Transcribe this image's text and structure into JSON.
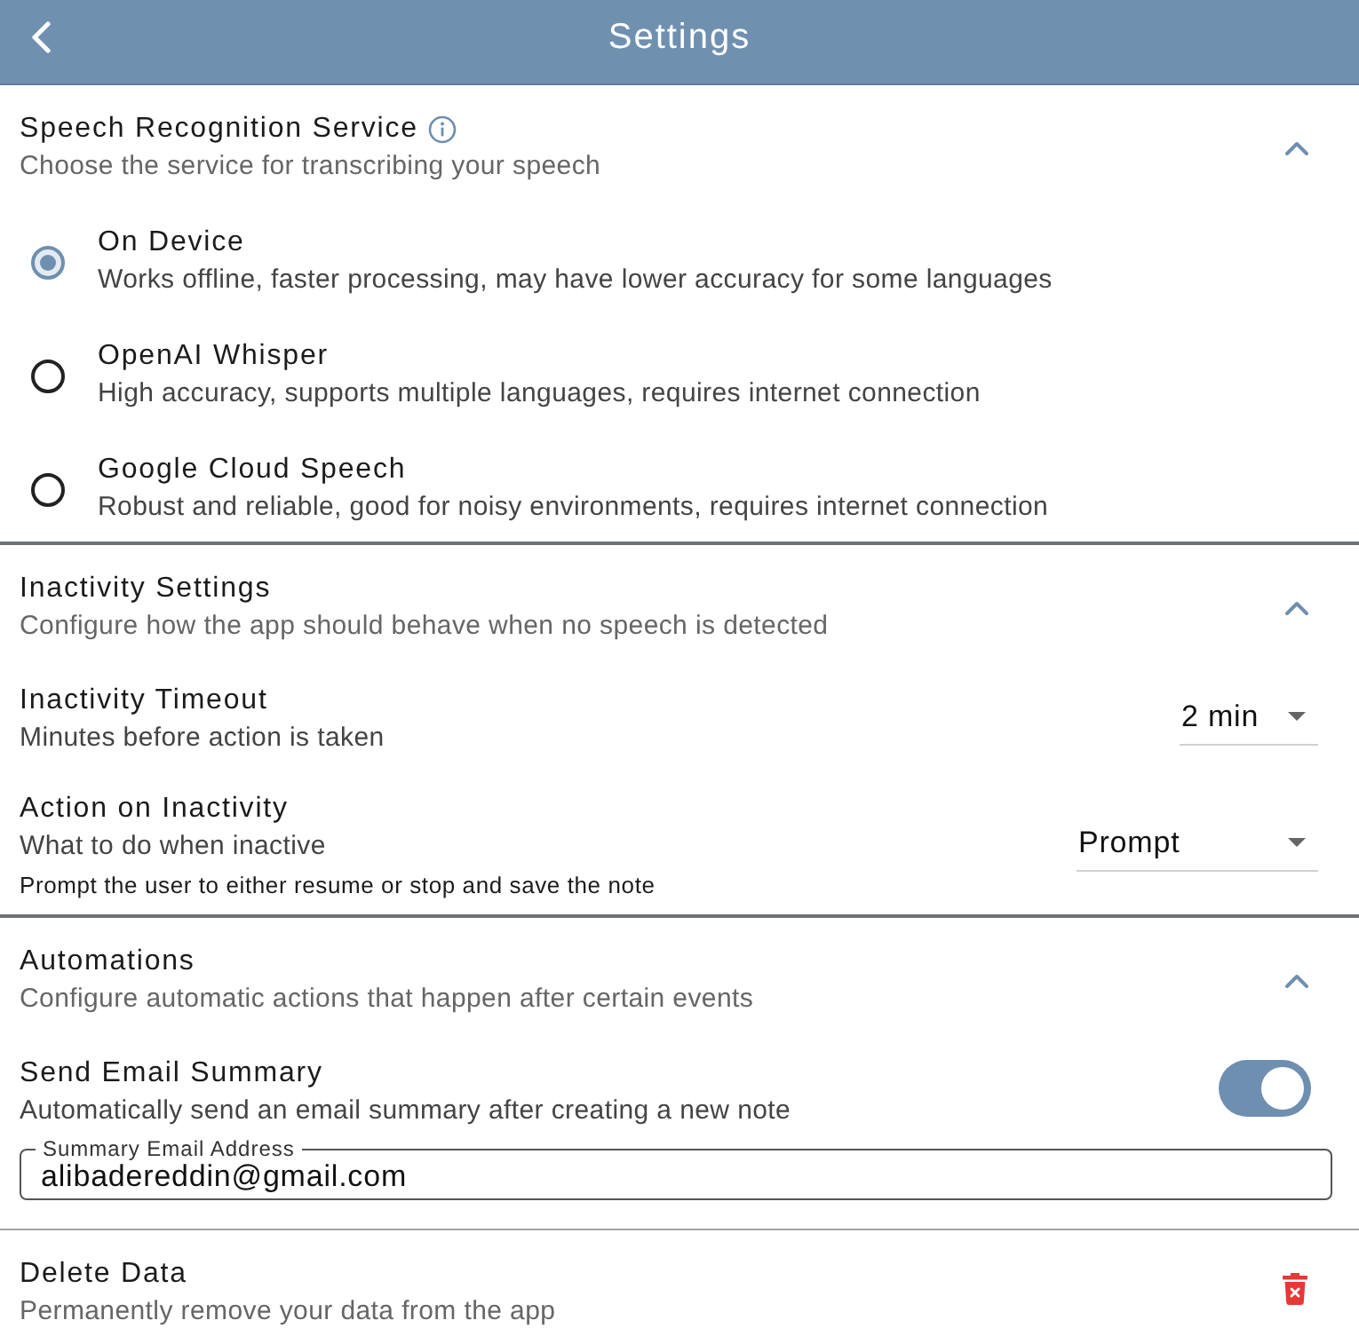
{
  "header": {
    "title": "Settings"
  },
  "sections": [
    {
      "kind": "radio",
      "title": "Speech Recognition Service",
      "info": true,
      "subtitle": "Choose the service for transcribing your speech",
      "expanded": true,
      "options": [
        {
          "label": "On Device",
          "description": "Works offline, faster processing, may have lower accuracy for some languages",
          "selected": true
        },
        {
          "label": "OpenAI Whisper",
          "description": "High accuracy, supports multiple languages, requires internet connection",
          "selected": false
        },
        {
          "label": "Google Cloud Speech",
          "description": "Robust and reliable, good for noisy environments, requires internet connection",
          "selected": false
        }
      ]
    },
    {
      "kind": "settings",
      "title": "Inactivity Settings",
      "subtitle": "Configure how the app should behave when no speech is detected",
      "expanded": true,
      "items": [
        {
          "kind": "select",
          "label": "Inactivity Timeout",
          "description": "Minutes before action is taken",
          "value": "2 min"
        },
        {
          "kind": "select",
          "label": "Action on Inactivity",
          "description": "What to do when inactive",
          "helper": "Prompt the user to either resume or stop and save the note",
          "value": "Prompt"
        }
      ]
    },
    {
      "kind": "settings",
      "title": "Automations",
      "subtitle": "Configure automatic actions that happen after certain events",
      "expanded": true,
      "items": [
        {
          "kind": "toggle",
          "label": "Send Email Summary",
          "description": "Automatically send an email summary after creating a new note",
          "on": true
        },
        {
          "kind": "email",
          "label": "Summary Email Address",
          "value": "alibadereddin@gmail.com"
        }
      ]
    },
    {
      "kind": "action",
      "title": "Delete Data",
      "subtitle": "Permanently remove your data from the app"
    }
  ]
}
